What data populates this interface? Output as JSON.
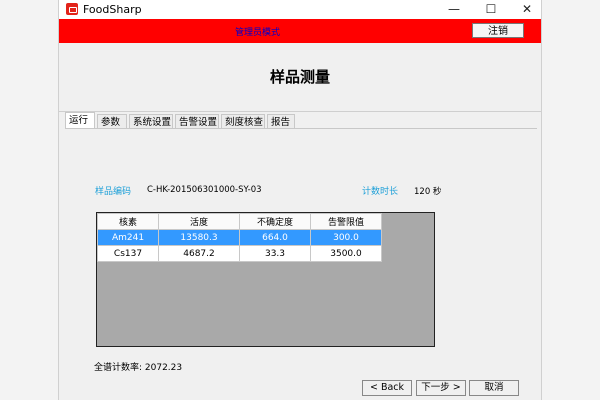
{
  "window": {
    "title": "FoodSharp",
    "minimize_glyph": "—",
    "maximize_glyph": "☐",
    "close_glyph": "✕"
  },
  "header": {
    "mode_label": "管理员模式",
    "logout_label": "注销",
    "bar_color": "#ff0000"
  },
  "page": {
    "title": "样品测量"
  },
  "tabs": [
    "运行",
    "参数",
    "系统设置",
    "告警设置",
    "刻度核查",
    "报告"
  ],
  "active_tab": "运行",
  "sample": {
    "id_label": "样品编码",
    "id_value": "C-HK-201506301000-SY-03"
  },
  "timer": {
    "label": "计数时长",
    "value": "120 秒"
  },
  "table": {
    "columns": [
      "核素",
      "活度",
      "不确定度",
      "告警限值"
    ],
    "rows": [
      [
        "Am241",
        "13580.3",
        "664.0",
        "300.0"
      ],
      [
        "Cs137",
        "4687.2",
        "33.3",
        "3500.0"
      ]
    ],
    "selected_row": 0,
    "selection_color": "#3399ff"
  },
  "footer": {
    "total_rate": "全谱计数率: 2072.23"
  },
  "buttons": {
    "back": "< Back",
    "next": "下一步 >",
    "cancel": "取消"
  },
  "colors": {
    "label_accent": "#1ea0d8"
  }
}
